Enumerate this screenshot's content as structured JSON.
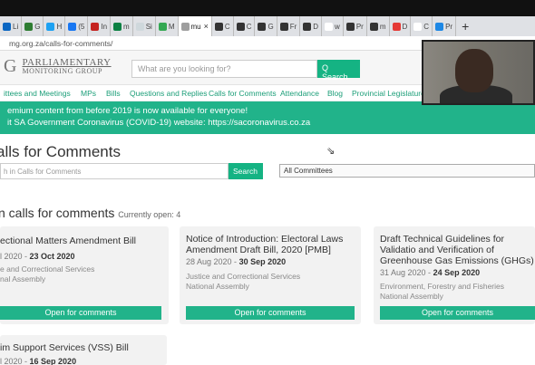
{
  "browser": {
    "tabs": [
      {
        "label": "Li",
        "color": "#0a66c2"
      },
      {
        "label": "G",
        "color": "#2e7d32"
      },
      {
        "label": "H",
        "color": "#1da1f2"
      },
      {
        "label": "(5",
        "color": "#1877f2"
      },
      {
        "label": "In",
        "color": "#c5221f"
      },
      {
        "label": "m",
        "color": "#0b8043"
      },
      {
        "label": "Si",
        "color": "#cfd8dc"
      },
      {
        "label": "M",
        "color": "#34a853"
      },
      {
        "label": "mu",
        "color": "#9e9e9e",
        "active": true,
        "close": "×"
      },
      {
        "label": "C",
        "color": "#333333"
      },
      {
        "label": "C",
        "color": "#333333"
      },
      {
        "label": "G",
        "color": "#333333"
      },
      {
        "label": "Fr",
        "color": "#333333"
      },
      {
        "label": "D",
        "color": "#333333"
      },
      {
        "label": "w",
        "color": "#ffffff"
      },
      {
        "label": "Pr",
        "color": "#333333"
      },
      {
        "label": "m",
        "color": "#333333"
      },
      {
        "label": "D",
        "color": "#e53935"
      },
      {
        "label": "C",
        "color": "#ffffff"
      },
      {
        "label": "Pr",
        "color": "#1e88e5"
      }
    ],
    "new_tab": "+",
    "url": "mg.org.za/calls-for-comments/"
  },
  "header": {
    "logo_letter": "G",
    "logo_line1": "PARLIAMENTARY",
    "logo_line2": "MONITORING GROUP",
    "search_placeholder": "What are you looking for?",
    "search_button": "Q Search"
  },
  "nav": [
    "ittees and Meetings",
    "MPs",
    "Bills",
    "Questions and Replies",
    "Calls for Comments",
    "Attendance",
    "Blog",
    "Provincial Legislatures"
  ],
  "banner": {
    "line1": "emium content from before 2019 is now available for everyone!",
    "line2": "it SA Government Coronavirus (COVID-19) website: https://sacoronavirus.co.za"
  },
  "page": {
    "title": "alls for Comments",
    "search_placeholder": "h in Calls for Comments",
    "search_button": "Search",
    "committee_select": "All Committees",
    "section_title": "n calls for comments",
    "section_count": "Currently open: 4"
  },
  "cards": [
    {
      "title": "ectional Matters Amendment Bill",
      "date_start": "l 2020 - ",
      "date_end": "23 Oct 2020",
      "committee": "e and Correctional Services",
      "house": "nal Assembly",
      "button": "Open for comments"
    },
    {
      "title": "Notice of Introduction: Electoral Laws Amendment Draft Bill, 2020 [PMB]",
      "date_start": "28 Aug 2020 - ",
      "date_end": "30 Sep 2020",
      "committee": "Justice and Correctional Services",
      "house": "National Assembly",
      "button": "Open for comments"
    },
    {
      "title": "Draft Technical Guidelines for Validatio and Verification of Greenhouse Gas Emissions (GHGs)",
      "date_start": "31 Aug 2020 - ",
      "date_end": "24 Sep 2020",
      "committee": "Environment, Forestry and Fisheries",
      "house": "National Assembly",
      "button": "Open for comments"
    },
    {
      "title": "im Support Services (VSS) Bill",
      "date_start": "l 2020 - ",
      "date_end": "16 Sep 2020",
      "committee": "",
      "house": "",
      "button": ""
    }
  ]
}
